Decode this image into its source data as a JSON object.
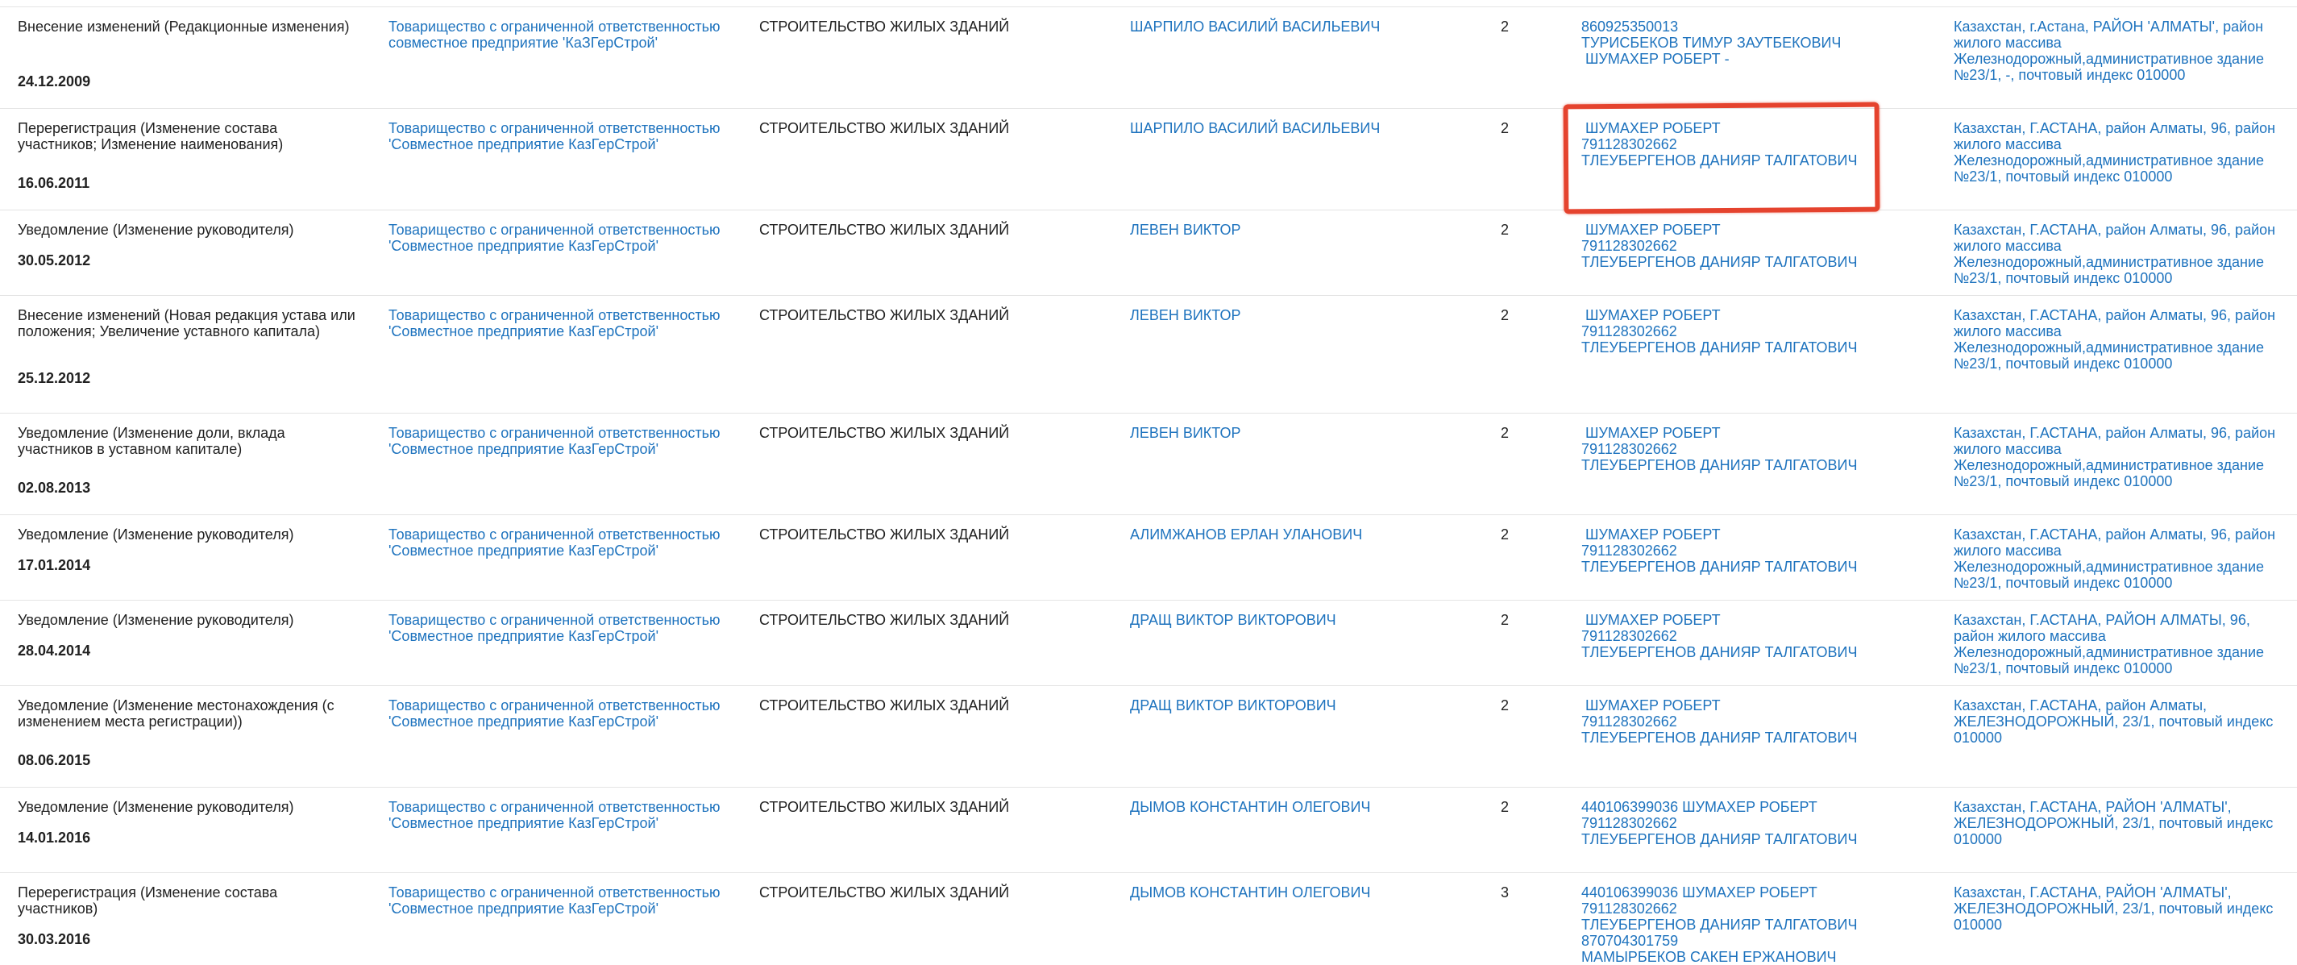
{
  "rows": [
    {
      "event": "Внесение изменений (Редакционные изменения)",
      "date": "24.12.2009",
      "org": "Товарищество с ограниченной ответственностью совместное предприятие 'КаЗГерСтрой'",
      "activity": "СТРОИТЕЛЬСТВО ЖИЛЫХ ЗДАНИЙ",
      "head": "ШАРПИЛО ВАСИЛИЙ ВАСИЛЬЕВИЧ",
      "count": "2",
      "founders": [
        "860925350013",
        "ТУРИСБЕКОВ ТИМУР ЗАУТБЕКОВИЧ",
        " ШУМАХЕР РОБЕРТ -"
      ],
      "address": "Казахстан, г.Астана, РАЙОН 'АЛМАТЫ', район жилого массива Железнодорожный,административное здание №23/1, -, почтовый индекс 010000"
    },
    {
      "event": "Перерегистрация (Изменение состава участников; Изменение наименования)",
      "date": "16.06.2011",
      "org": "Товарищество с ограниченной ответственностью 'Совместное предприятие КазГерСтрой'",
      "activity": "СТРОИТЕЛЬСТВО ЖИЛЫХ ЗДАНИЙ",
      "head": "ШАРПИЛО ВАСИЛИЙ ВАСИЛЬЕВИЧ",
      "count": "2",
      "founders": [
        " ШУМАХЕР РОБЕРТ",
        "791128302662",
        "ТЛЕУБЕРГЕНОВ ДАНИЯР ТАЛГАТОВИЧ"
      ],
      "address": "Казахстан, Г.АСТАНА, район Алматы, 96, район жилого массива Железнодорожный,административное здание №23/1, почтовый индекс 010000"
    },
    {
      "event": "Уведомление (Изменение руководителя)",
      "date": "30.05.2012",
      "org": "Товарищество с ограниченной ответственностью 'Совместное предприятие КазГерСтрой'",
      "activity": "СТРОИТЕЛЬСТВО ЖИЛЫХ ЗДАНИЙ",
      "head": "ЛЕВЕН ВИКТОР",
      "count": "2",
      "founders": [
        " ШУМАХЕР РОБЕРТ",
        "791128302662",
        "ТЛЕУБЕРГЕНОВ ДАНИЯР ТАЛГАТОВИЧ"
      ],
      "address": "Казахстан, Г.АСТАНА, район Алматы, 96, район жилого массива Железнодорожный,административное здание №23/1, почтовый индекс 010000"
    },
    {
      "event": "Внесение изменений (Новая редакция устава или положения; Увеличение уставного капитала)",
      "date": "25.12.2012",
      "org": "Товарищество с ограниченной ответственностью 'Совместное предприятие КазГерСтрой'",
      "activity": "СТРОИТЕЛЬСТВО ЖИЛЫХ ЗДАНИЙ",
      "head": "ЛЕВЕН ВИКТОР",
      "count": "2",
      "founders": [
        " ШУМАХЕР РОБЕРТ",
        "791128302662",
        "ТЛЕУБЕРГЕНОВ ДАНИЯР ТАЛГАТОВИЧ"
      ],
      "address": "Казахстан, Г.АСТАНА, район Алматы, 96, район жилого массива Железнодорожный,административное здание №23/1, почтовый индекс 010000"
    },
    {
      "event": "Уведомление (Изменение доли, вклада участников в уставном капитале)",
      "date": "02.08.2013",
      "org": "Товарищество с ограниченной ответственностью 'Совместное предприятие КазГерСтрой'",
      "activity": "СТРОИТЕЛЬСТВО ЖИЛЫХ ЗДАНИЙ",
      "head": "ЛЕВЕН ВИКТОР",
      "count": "2",
      "founders": [
        " ШУМАХЕР РОБЕРТ",
        "791128302662",
        "ТЛЕУБЕРГЕНОВ ДАНИЯР ТАЛГАТОВИЧ"
      ],
      "address": "Казахстан, Г.АСТАНА, район Алматы, 96, район жилого массива Железнодорожный,административное здание №23/1, почтовый индекс 010000"
    },
    {
      "event": "Уведомление (Изменение руководителя)",
      "date": "17.01.2014",
      "org": "Товарищество с ограниченной ответственностью 'Совместное предприятие КазГерСтрой'",
      "activity": "СТРОИТЕЛЬСТВО ЖИЛЫХ ЗДАНИЙ",
      "head": "АЛИМЖАНОВ ЕРЛАН УЛАНОВИЧ",
      "count": "2",
      "founders": [
        " ШУМАХЕР РОБЕРТ",
        "791128302662",
        "ТЛЕУБЕРГЕНОВ ДАНИЯР ТАЛГАТОВИЧ"
      ],
      "address": "Казахстан, Г.АСТАНА, район Алматы, 96, район жилого массива Железнодорожный,административное здание №23/1, почтовый индекс 010000"
    },
    {
      "event": "Уведомление (Изменение руководителя)",
      "date": "28.04.2014",
      "org": "Товарищество с ограниченной ответственностью 'Совместное предприятие КазГерСтрой'",
      "activity": "СТРОИТЕЛЬСТВО ЖИЛЫХ ЗДАНИЙ",
      "head": "ДРАЩ ВИКТОР ВИКТОРОВИЧ",
      "count": "2",
      "founders": [
        " ШУМАХЕР РОБЕРТ",
        "791128302662",
        "ТЛЕУБЕРГЕНОВ ДАНИЯР ТАЛГАТОВИЧ"
      ],
      "address": "Казахстан, Г.АСТАНА, РАЙОН АЛМАТЫ, 96, район жилого массива Железнодорожный,административное здание №23/1, почтовый индекс 010000"
    },
    {
      "event": "Уведомление (Изменение местонахождения (с изменением места регистрации))",
      "date": "08.06.2015",
      "org": "Товарищество с ограниченной ответственностью 'Совместное предприятие КазГерСтрой'",
      "activity": "СТРОИТЕЛЬСТВО ЖИЛЫХ ЗДАНИЙ",
      "head": "ДРАЩ ВИКТОР ВИКТОРОВИЧ",
      "count": "2",
      "founders": [
        " ШУМАХЕР РОБЕРТ",
        "791128302662",
        "ТЛЕУБЕРГЕНОВ ДАНИЯР ТАЛГАТОВИЧ"
      ],
      "address": "Казахстан, Г.АСТАНА, район Алматы, ЖЕЛЕЗНОДОРОЖНЫЙ, 23/1, почтовый индекс 010000"
    },
    {
      "event": "Уведомление (Изменение руководителя)",
      "date": "14.01.2016",
      "org": "Товарищество с ограниченной ответственностью 'Совместное предприятие КазГерСтрой'",
      "activity": "СТРОИТЕЛЬСТВО ЖИЛЫХ ЗДАНИЙ",
      "head": "ДЫМОВ КОНСТАНТИН ОЛЕГОВИЧ",
      "count": "2",
      "founders": [
        "440106399036 ШУМАХЕР РОБЕРТ",
        "791128302662",
        "ТЛЕУБЕРГЕНОВ ДАНИЯР ТАЛГАТОВИЧ"
      ],
      "address": "Казахстан, Г.АСТАНА, РАЙОН 'АЛМАТЫ', ЖЕЛЕЗНОДОРОЖНЫЙ, 23/1, почтовый индекс 010000"
    },
    {
      "event": "Перерегистрация (Изменение состава участников)",
      "date": "30.03.2016",
      "org": "Товарищество с ограниченной ответственностью 'Совместное предприятие КазГерСтрой'",
      "activity": "СТРОИТЕЛЬСТВО ЖИЛЫХ ЗДАНИЙ",
      "head": "ДЫМОВ КОНСТАНТИН ОЛЕГОВИЧ",
      "count": "3",
      "founders": [
        "440106399036 ШУМАХЕР РОБЕРТ",
        "791128302662",
        "ТЛЕУБЕРГЕНОВ ДАНИЯР ТАЛГАТОВИЧ",
        "870704301759",
        "МАМЫРБЕКОВ САКЕН ЕРЖАНОВИЧ"
      ],
      "address": "Казахстан, Г.АСТАНА, РАЙОН 'АЛМАТЫ', ЖЕЛЕЗНОДОРОЖНЫЙ, 23/1, почтовый индекс 010000"
    }
  ],
  "highlight_color": "#e5432e",
  "link_color": "#1e73be"
}
